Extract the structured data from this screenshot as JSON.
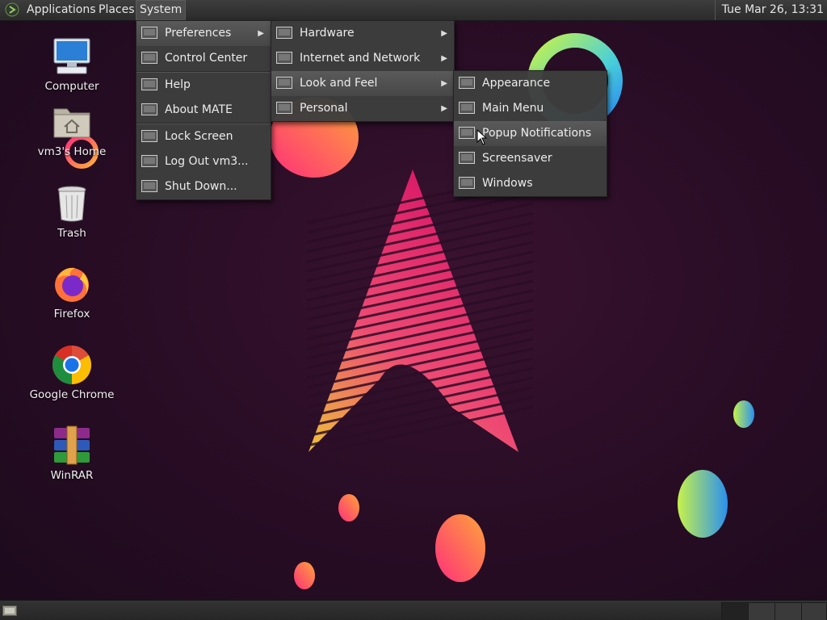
{
  "top_panel": {
    "applications_label": "Applications",
    "places_label": "Places",
    "system_label": "System",
    "clock": "Tue Mar 26, 13:31"
  },
  "desktop_icons": [
    {
      "label": "Computer",
      "icon": "computer-icon"
    },
    {
      "label": "vm3's Home",
      "icon": "home-folder-icon"
    },
    {
      "label": "Trash",
      "icon": "trash-icon"
    },
    {
      "label": "Firefox",
      "icon": "firefox-icon"
    },
    {
      "label": "Google Chrome",
      "icon": "chrome-icon"
    },
    {
      "label": "WinRAR",
      "icon": "winrar-icon"
    }
  ],
  "system_menu": {
    "items": [
      {
        "label": "Preferences",
        "submenu": true
      },
      {
        "label": "Control Center"
      },
      {
        "label": "Help"
      },
      {
        "label": "About MATE"
      },
      {
        "label": "Lock Screen"
      },
      {
        "label": "Log Out vm3..."
      },
      {
        "label": "Shut Down..."
      }
    ]
  },
  "preferences_menu": {
    "items": [
      {
        "label": "Hardware",
        "submenu": true
      },
      {
        "label": "Internet and Network",
        "submenu": true
      },
      {
        "label": "Look and Feel",
        "submenu": true
      },
      {
        "label": "Personal",
        "submenu": true
      }
    ]
  },
  "look_and_feel_menu": {
    "items": [
      {
        "label": "Appearance"
      },
      {
        "label": "Main Menu"
      },
      {
        "label": "Popup Notifications"
      },
      {
        "label": "Screensaver"
      },
      {
        "label": "Windows"
      }
    ]
  },
  "colors": {
    "wallpaper_bg": "#2a0d26",
    "panel_bg": "#2f2f2f",
    "menu_bg": "#3e3e3e",
    "menu_highlight": "#505050"
  }
}
